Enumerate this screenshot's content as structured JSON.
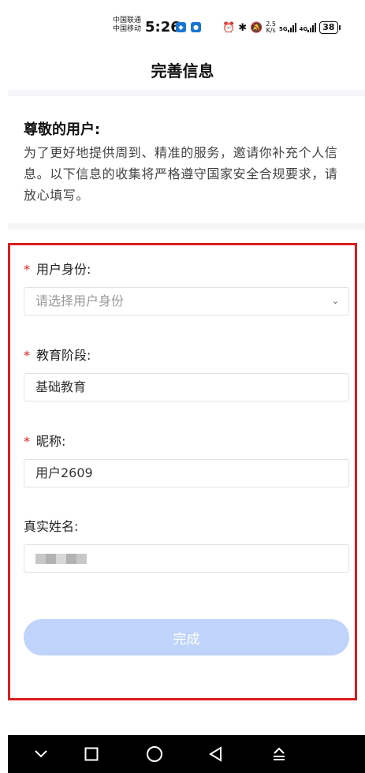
{
  "status_bar": {
    "carrier_1": "中国联通",
    "carrier_2": "中国移动",
    "time": "5:26",
    "net_speed_value": "2.5",
    "net_speed_unit": "K/s",
    "network_5g": "5G",
    "network_4g": "4G",
    "battery": "38"
  },
  "header": {
    "title": "完善信息"
  },
  "intro": {
    "title": "尊敬的用户:",
    "text": "为了更好地提供周到、精准的服务，邀请你补充个人信息。以下信息的收集将严格遵守国家安全合规要求，请放心填写。"
  },
  "form": {
    "required_mark": "*",
    "identity": {
      "label": "用户身份:",
      "placeholder": "请选择用户身份"
    },
    "education": {
      "label": "教育阶段:",
      "value": "基础教育"
    },
    "nickname": {
      "label": "昵称:",
      "value": "用户2609"
    },
    "real_name": {
      "label": "真实姓名:"
    },
    "submit_label": "完成"
  },
  "colors": {
    "accent_button": "#bfd3fb",
    "required": "#e02020",
    "highlight_border": "#d81e1e"
  },
  "icons": {
    "nav_down": "chevron-down-icon",
    "nav_recents": "square-icon",
    "nav_home": "circle-icon",
    "nav_back": "triangle-back-icon",
    "nav_keyboard": "keyboard-hide-icon"
  }
}
